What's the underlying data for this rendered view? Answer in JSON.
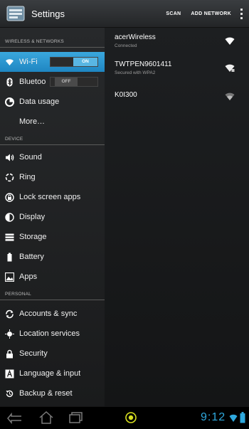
{
  "actionbar": {
    "title": "Settings",
    "actions": [
      "SCAN",
      "ADD NETWORK"
    ]
  },
  "sidebar": {
    "sections": [
      {
        "header": "WIRELESS & NETWORKS",
        "items": [
          {
            "label": "Wi-Fi",
            "icon": "wifi-icon",
            "toggle": "ON",
            "active": true
          },
          {
            "label": "Bluetoo",
            "icon": "bluetooth-icon",
            "toggle": "OFF"
          },
          {
            "label": "Data usage",
            "icon": "data-usage-icon"
          },
          {
            "label": "More…",
            "icon": ""
          }
        ]
      },
      {
        "header": "DEVICE",
        "items": [
          {
            "label": "Sound",
            "icon": "speaker-icon"
          },
          {
            "label": "Ring",
            "icon": "ring-icon"
          },
          {
            "label": "Lock screen apps",
            "icon": "lock-screen-icon"
          },
          {
            "label": "Display",
            "icon": "display-icon"
          },
          {
            "label": "Storage",
            "icon": "storage-icon"
          },
          {
            "label": "Battery",
            "icon": "battery-icon"
          },
          {
            "label": "Apps",
            "icon": "apps-icon"
          }
        ]
      },
      {
        "header": "PERSONAL",
        "items": [
          {
            "label": "Accounts & sync",
            "icon": "sync-icon"
          },
          {
            "label": "Location services",
            "icon": "location-icon"
          },
          {
            "label": "Security",
            "icon": "lock-icon"
          },
          {
            "label": "Language & input",
            "icon": "language-icon"
          },
          {
            "label": "Backup & reset",
            "icon": "backup-icon"
          }
        ]
      }
    ]
  },
  "networks": [
    {
      "name": "acerWireless",
      "status": "Connected",
      "secured": false
    },
    {
      "name": "TWTPEN9601411",
      "status": "Secured with WPA2",
      "secured": true
    },
    {
      "name": "K0I300",
      "status": "",
      "secured": false
    }
  ],
  "statusbar": {
    "time": "9:12",
    "accent": "#2fa9de"
  }
}
